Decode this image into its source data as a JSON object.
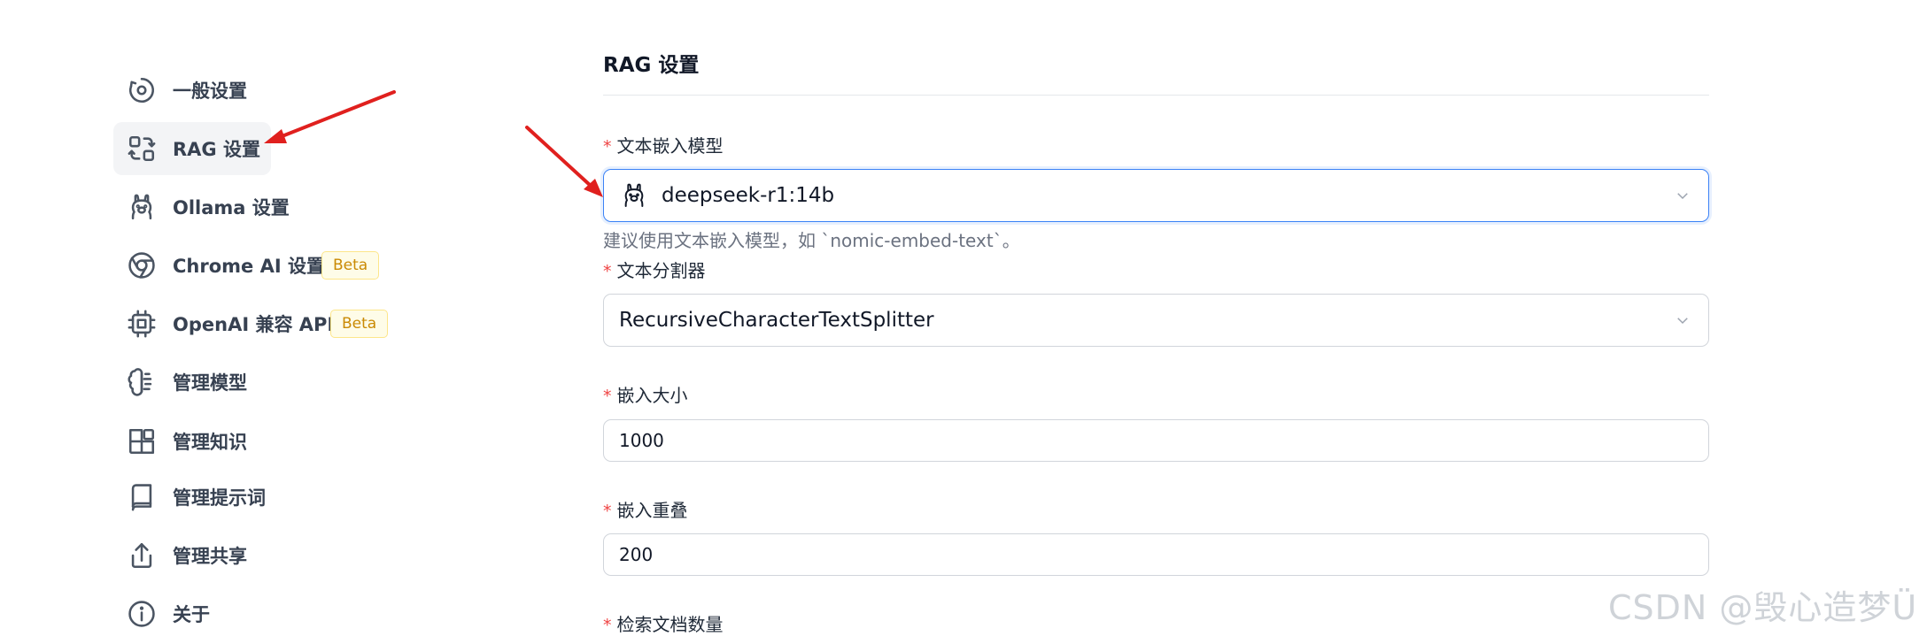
{
  "sidebar": {
    "items": [
      {
        "label": "一般设置",
        "icon": "gear-icon"
      },
      {
        "label": "RAG 设置",
        "icon": "rag-icon"
      },
      {
        "label": "Ollama 设置",
        "icon": "llama-icon"
      },
      {
        "label": "Chrome AI 设置",
        "icon": "chrome-icon",
        "badge": "Beta"
      },
      {
        "label": "OpenAI 兼容 API",
        "icon": "cpu-icon",
        "badge": "Beta"
      },
      {
        "label": "管理模型",
        "icon": "brain-icon"
      },
      {
        "label": "管理知识",
        "icon": "blocks-icon"
      },
      {
        "label": "管理提示词",
        "icon": "book-icon"
      },
      {
        "label": "管理共享",
        "icon": "share-icon"
      },
      {
        "label": "关于",
        "icon": "info-icon"
      }
    ],
    "active_index": 1
  },
  "main": {
    "title": "RAG 设置",
    "fields": {
      "embedding_model": {
        "label": "文本嵌入模型",
        "value": "deepseek-r1:14b",
        "help": "建议使用文本嵌入模型，如 `nomic-embed-text`。",
        "icon": "llama-icon"
      },
      "splitter": {
        "label": "文本分割器",
        "value": "RecursiveCharacterTextSplitter"
      },
      "chunk_size": {
        "label": "嵌入大小",
        "value": "1000"
      },
      "chunk_overlap": {
        "label": "嵌入重叠",
        "value": "200"
      },
      "retrieval_count": {
        "label": "检索文档数量"
      }
    },
    "required_marker": "*"
  },
  "watermark": "CSDN @毁心造梦Ü",
  "colors": {
    "accent_blue": "#3b82f6",
    "required_red": "#ef4444",
    "beta_text": "#ca8a04",
    "arrow_red": "#e0201e"
  }
}
